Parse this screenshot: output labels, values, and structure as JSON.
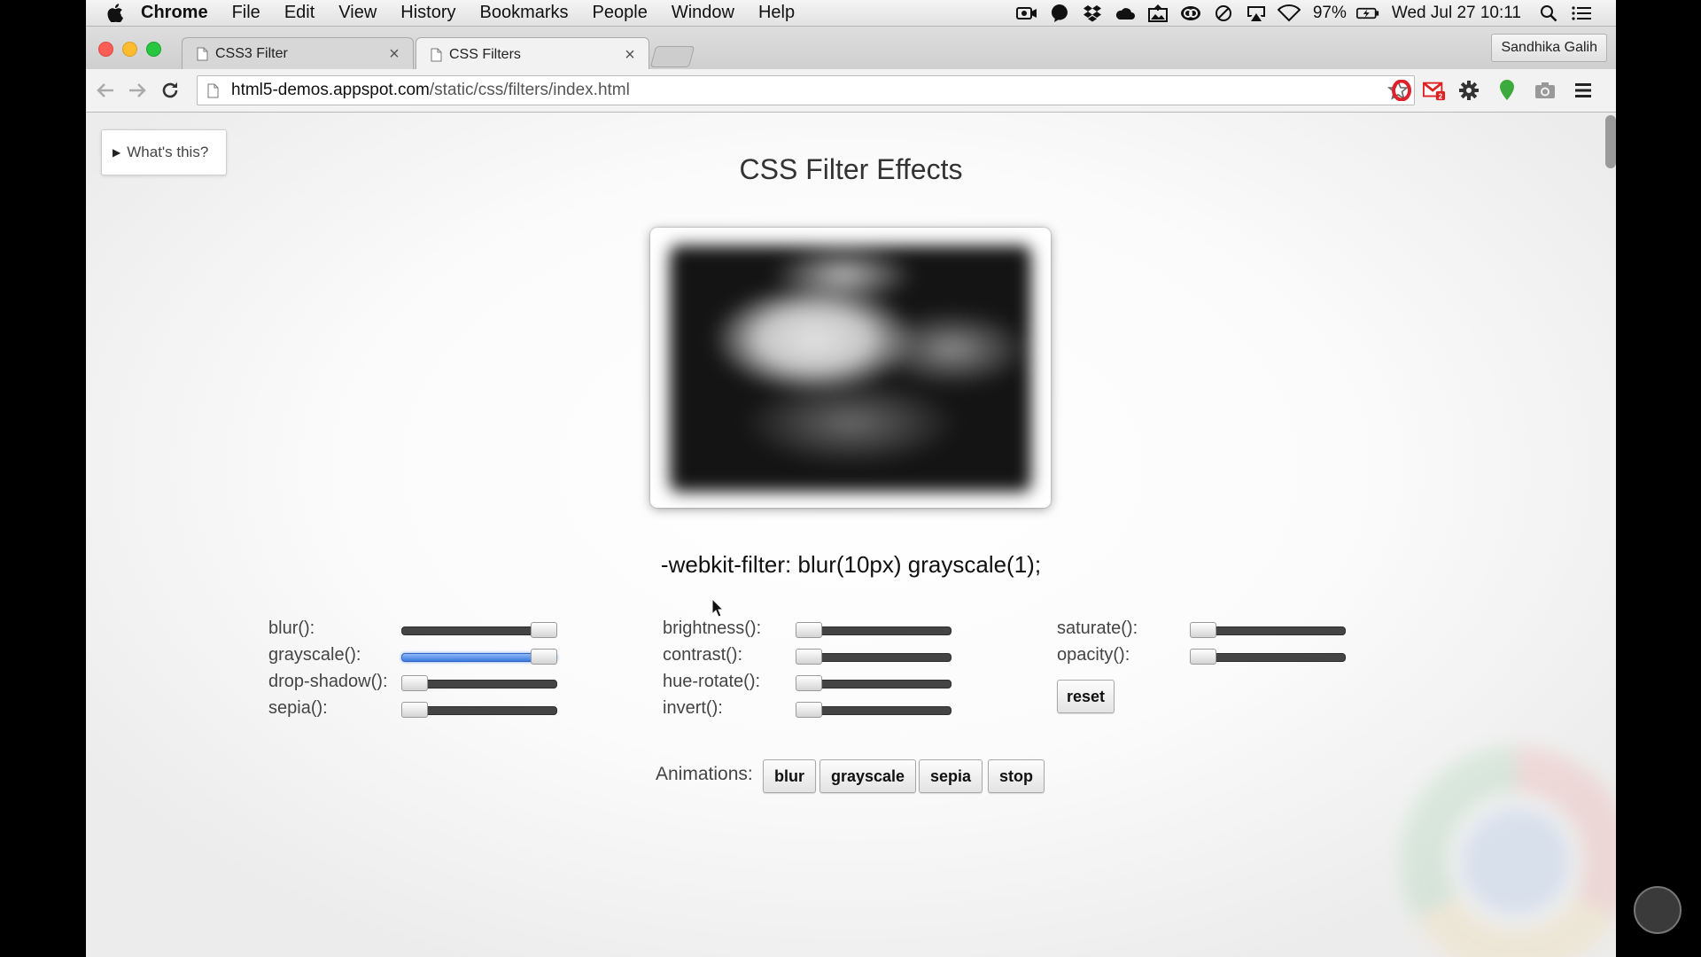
{
  "menubar": {
    "app": "Chrome",
    "items": [
      "File",
      "Edit",
      "View",
      "History",
      "Bookmarks",
      "People",
      "Window",
      "Help"
    ],
    "battery": "97%",
    "datetime": "Wed Jul 27  10:11"
  },
  "tabs": [
    {
      "title": "CSS3 Filter",
      "active": false
    },
    {
      "title": "CSS Filters",
      "active": true
    }
  ],
  "profile_name": "Sandhika Galih",
  "address": {
    "host": "html5-demos.appspot.com",
    "path": "/static/css/filters/index.html"
  },
  "page": {
    "whats_this": "What's this?",
    "title": "CSS Filter Effects",
    "code_line": "-webkit-filter: blur(10px) grayscale(1);",
    "sliders": [
      {
        "label": "blur():",
        "value": 1.0,
        "active": false
      },
      {
        "label": "grayscale():",
        "value": 1.0,
        "active": true
      },
      {
        "label": "drop-shadow():",
        "value": 0.0,
        "active": false
      },
      {
        "label": "sepia():",
        "value": 0.0,
        "active": false
      },
      {
        "label": "brightness():",
        "value": 0.0,
        "active": false
      },
      {
        "label": "contrast():",
        "value": 0.0,
        "active": false
      },
      {
        "label": "hue-rotate():",
        "value": 0.0,
        "active": false
      },
      {
        "label": "invert():",
        "value": 0.0,
        "active": false
      },
      {
        "label": "saturate():",
        "value": 0.0,
        "active": false
      },
      {
        "label": "opacity():",
        "value": 0.0,
        "active": false
      }
    ],
    "reset_label": "reset",
    "animations_label": "Animations:",
    "animation_buttons": [
      "blur",
      "grayscale",
      "sepia",
      "stop"
    ]
  },
  "colors": {
    "slider_active": "#3d7ae0",
    "track": "#444444"
  }
}
